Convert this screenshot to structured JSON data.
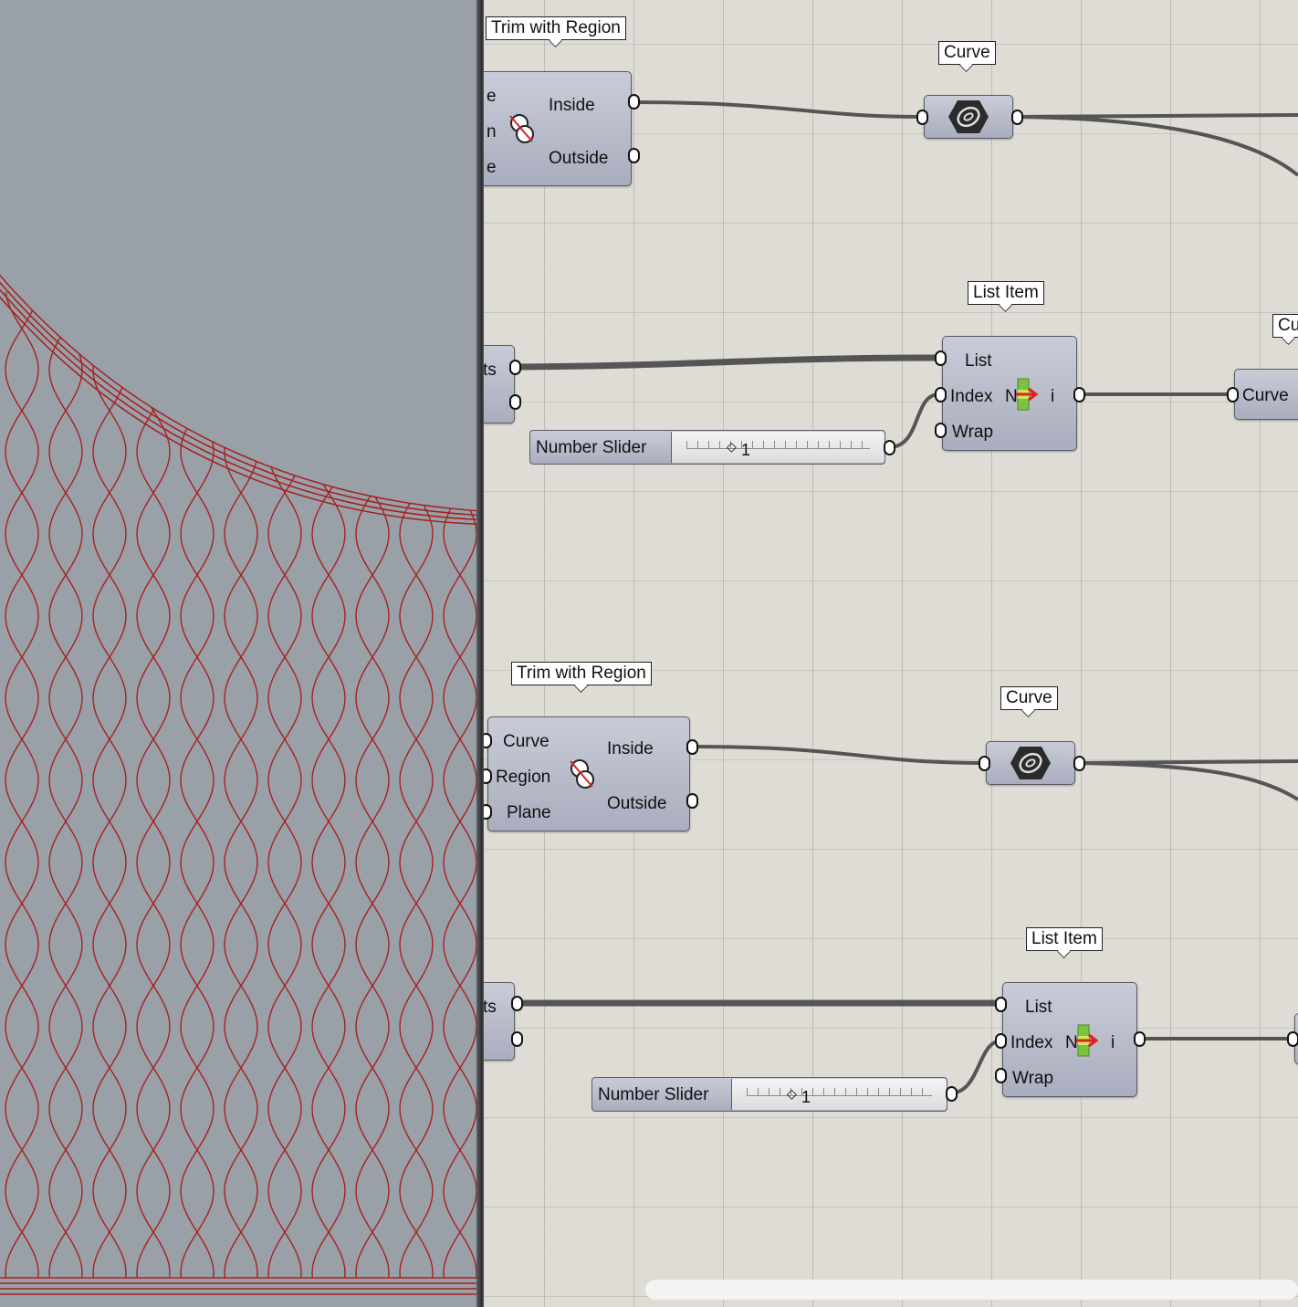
{
  "viewport": {
    "curve_color": "#a52222"
  },
  "components": {
    "trim1": {
      "title": "Trim with Region",
      "inputs": [
        "e",
        "n",
        "e"
      ],
      "outputs": [
        "Inside",
        "Outside"
      ]
    },
    "curve1": {
      "title": "Curve"
    },
    "list1": {
      "title": "List Item",
      "inputs": [
        "List",
        "Index",
        "Wrap"
      ],
      "output": "i",
      "icon_letter": "N"
    },
    "ts1": {
      "label": "ts"
    },
    "slider1": {
      "name": "Number Slider",
      "value": "1"
    },
    "curve_param1": {
      "tag": "Cu",
      "label": "Curve"
    },
    "trim2": {
      "title": "Trim with Region",
      "inputs": [
        "Curve",
        "Region",
        "Plane"
      ],
      "outputs": [
        "Inside",
        "Outside"
      ]
    },
    "curve2": {
      "title": "Curve"
    },
    "list2": {
      "title": "List Item",
      "inputs": [
        "List",
        "Index",
        "Wrap"
      ],
      "output": "i",
      "icon_letter": "N"
    },
    "ts2": {
      "label": "ts"
    },
    "slider2": {
      "name": "Number Slider",
      "value": "1"
    }
  }
}
